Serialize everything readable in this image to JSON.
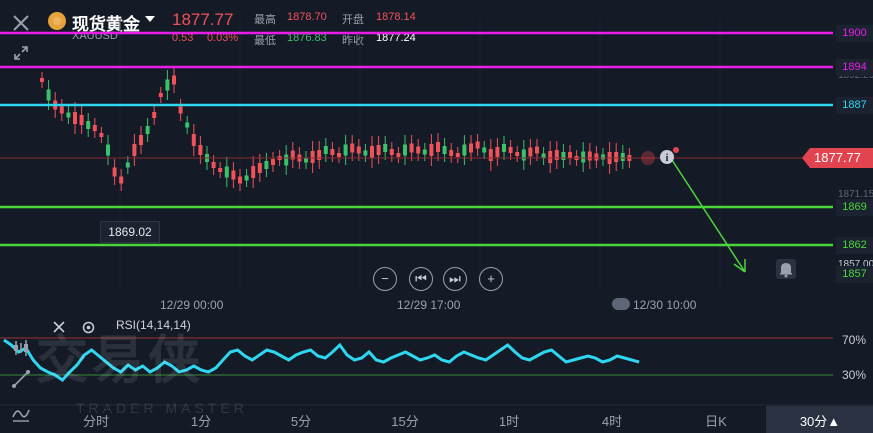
{
  "header": {
    "title": "现货黄金",
    "symbol": "XAUUSD",
    "price": "1877.77",
    "change": "0.53",
    "change_pct": "0.03%",
    "high_label": "最高",
    "high": "1878.70",
    "open_label": "开盘",
    "open": "1878.14",
    "low_label": "最低",
    "low": "1876.83",
    "prev_label": "昨收",
    "prev": "1877.24"
  },
  "levels": {
    "l1900": "1900",
    "l1894": "1894",
    "l1887": "1887",
    "l1869": "1869",
    "l1862": "1862",
    "l1857": "1857",
    "current": "1877.77",
    "tick_1892": "1892.20",
    "tick_1871": "1871.15",
    "tick_1857": "1857.00"
  },
  "colors": {
    "magenta": "#e81ee8",
    "cyan": "#2fd6f0",
    "green_line": "#4bd63a",
    "up": "#f0525a",
    "down": "#3bc06b",
    "rsi": "#2fd6f0",
    "price_tag": "#e2444f"
  },
  "annotations": {
    "low_marker": "1869.02"
  },
  "time_axis": [
    "12/29 00:00",
    "12/29 17:00",
    "12/30 10:00"
  ],
  "rsi": {
    "label": "RSI(14,14,14)",
    "upper": "70%",
    "lower": "30%"
  },
  "tabs": [
    "分时",
    "1分",
    "5分",
    "15分",
    "1时",
    "4时",
    "日K",
    "30分▲"
  ],
  "watermark": {
    "cn": "交易侠",
    "en": "TRADER MASTER"
  },
  "icons": [
    "close-icon",
    "expand-icon",
    "info-icon",
    "bell-icon",
    "zoom-out-icon",
    "prev-icon",
    "next-icon",
    "zoom-in-icon",
    "settings-icon"
  ]
}
